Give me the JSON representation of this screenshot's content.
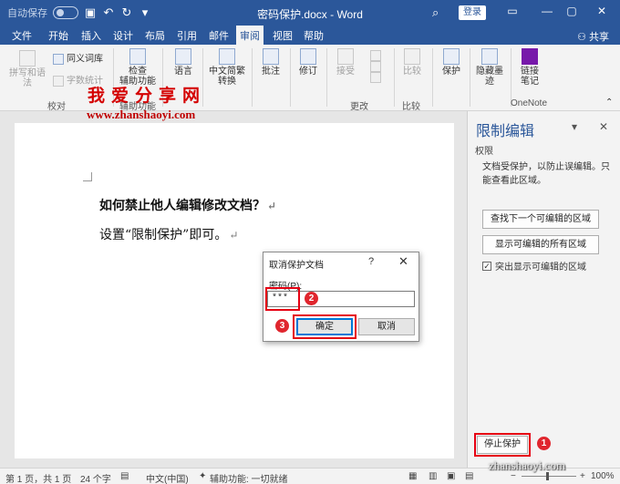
{
  "titlebar": {
    "autosave": "自动保存",
    "title": "密码保护.docx - Word",
    "login": "登录",
    "icons": [
      "save-icon",
      "undo-icon",
      "redo-icon",
      "customize-icon",
      "search-icon",
      "ribbon-display-icon",
      "minimize-icon",
      "restore-icon",
      "close-icon"
    ]
  },
  "tabs": [
    "文件",
    "开始",
    "插入",
    "设计",
    "布局",
    "引用",
    "邮件",
    "审阅",
    "视图",
    "帮助"
  ],
  "active_tab": "审阅",
  "share": "共享",
  "ribbon": {
    "proofing": {
      "spell": "拼写和语法",
      "thesaurus": "同义词库",
      "wordcount": "字数统计",
      "label": "校对"
    },
    "accessibility": {
      "check": "检查",
      "check2": "辅助功能",
      "label": "辅助功能"
    },
    "language": {
      "btn": "语言"
    },
    "chinese": {
      "btn": "中文简繁",
      "btn2": "转换"
    },
    "comments": {
      "btn": "批注"
    },
    "tracking": {
      "btn": "修订"
    },
    "changes": {
      "accept": "接受",
      "label": "更改"
    },
    "compare": {
      "btn": "比较",
      "label": "比较"
    },
    "protect": {
      "btn": "保护"
    },
    "ink": {
      "btn": "隐藏墨",
      "btn2": "迹"
    },
    "onenote": {
      "btn": "链接",
      "btn2": "笔记",
      "label": "OneNote"
    }
  },
  "watermark": {
    "title": "我爱分享网",
    "url": "www.zhanshaoyi.com",
    "url2": "zhanshaoyi.com"
  },
  "document": {
    "line1": "如何禁止他人编辑修改文档？",
    "line2": "设置“限制保护”即可。",
    "para_mark": "↵"
  },
  "pane": {
    "title": "限制编辑",
    "section": "权限",
    "text": "文档受保护，以防止误编辑。只能查看此区域。",
    "btn_next": "查找下一个可编辑的区域",
    "btn_show_all": "显示可编辑的所有区域",
    "highlight": "突出显示可编辑的区域",
    "highlight_checked": true,
    "stop": "停止保护"
  },
  "dialog": {
    "title": "取消保护文档",
    "help": "?",
    "password_label": "密码(P):",
    "password_value": "***",
    "ok": "确定",
    "cancel": "取消"
  },
  "badges": [
    "1",
    "2",
    "3"
  ],
  "status": {
    "page": "第 1 页，共 1 页",
    "words": "24 个字",
    "lang": "中文(中国)",
    "access": "辅助功能: 一切就绪",
    "zoom": "100%"
  },
  "colors": {
    "accent": "#2b579a",
    "annotation": "#e60012"
  }
}
